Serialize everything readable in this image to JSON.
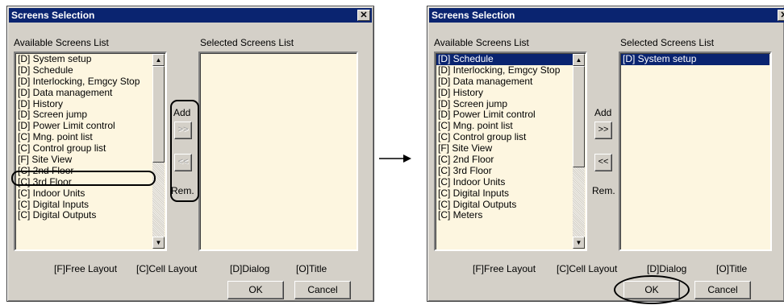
{
  "left_dialog": {
    "title": "Screens Selection",
    "close_label": "✕",
    "available_label": "Available Screens List",
    "selected_label": "Selected Screens List",
    "available_items": [
      "[D] System setup",
      "[D] Schedule",
      "[D] Interlocking, Emgcy Stop",
      "[D] Data management",
      "[D] History",
      "[D] Screen jump",
      "[D] Power Limit control",
      "[C] Mng. point list",
      "[C] Control group list",
      "[F] Site View",
      "[C] 2nd Floor",
      "[C] 3rd Floor",
      "[C] Indoor Units",
      "[C] Digital Inputs",
      "[C] Digital Outputs"
    ],
    "selected_items": [],
    "add_label": "Add",
    "add_button": ">>",
    "remove_button": "<<",
    "remove_label": "Rem.",
    "legend": [
      "[F]Free Layout",
      "[C]Cell Layout",
      "[D]Dialog",
      "[O]Title"
    ],
    "ok_label": "OK",
    "cancel_label": "Cancel"
  },
  "right_dialog": {
    "title": "Screens Selection",
    "close_label": "✕",
    "available_label": "Available Screens List",
    "selected_label": "Selected Screens List",
    "available_items": [
      "[D] Schedule",
      "[D] Interlocking, Emgcy Stop",
      "[D] Data management",
      "[D] History",
      "[D] Screen jump",
      "[D] Power Limit control",
      "[C] Mng. point list",
      "[C] Control group list",
      "[F] Site View",
      "[C] 2nd Floor",
      "[C] 3rd Floor",
      "[C] Indoor Units",
      "[C] Digital Inputs",
      "[C] Digital Outputs",
      "[C] Meters"
    ],
    "selected_items": [
      "[D] System setup"
    ],
    "add_label": "Add",
    "add_button": ">>",
    "remove_button": "<<",
    "remove_label": "Rem.",
    "legend": [
      "[F]Free Layout",
      "[C]Cell Layout",
      "[D]Dialog",
      "[O]Title"
    ],
    "ok_label": "OK",
    "cancel_label": "Cancel"
  },
  "colors": {
    "dialog_bg": "#d4d0c8",
    "titlebar": "#0a2470",
    "list_bg": "#fdf6e0",
    "selection": "#0a2470"
  }
}
